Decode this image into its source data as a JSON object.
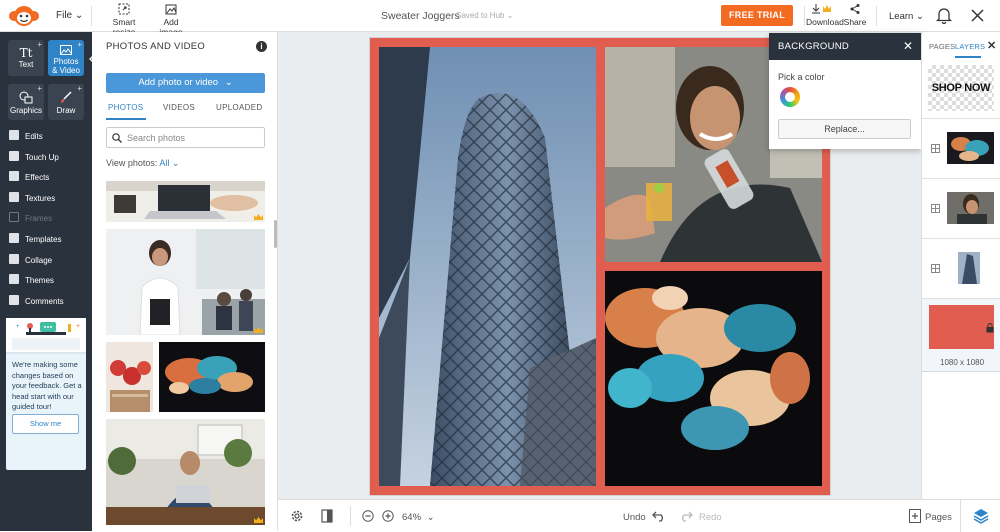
{
  "topbar": {
    "file_label": "File",
    "tools": [
      {
        "label": "Smart resize",
        "icon": "smart-resize-icon"
      },
      {
        "label": "Add image",
        "icon": "add-image-icon"
      }
    ],
    "doc_title": "Sweater Joggers",
    "saved_status": "Saved to Hub",
    "trial_label": "FREE TRIAL",
    "download_label": "Download",
    "share_label": "Share",
    "learn_label": "Learn"
  },
  "leftnav": {
    "tiles": [
      {
        "label_line1": "Text",
        "glyph": "Tt"
      },
      {
        "label_line1": "Photos",
        "label_line2": "& Video"
      },
      {
        "label_line1": "Graphics"
      },
      {
        "label_line1": "Draw"
      }
    ],
    "items": [
      {
        "label": "Edits"
      },
      {
        "label": "Touch Up"
      },
      {
        "label": "Effects"
      },
      {
        "label": "Textures"
      },
      {
        "label": "Frames"
      },
      {
        "label": "Templates"
      },
      {
        "label": "Collage"
      },
      {
        "label": "Themes"
      },
      {
        "label": "Comments"
      }
    ],
    "promo_text": "We're making some changes based on your feedback. Get a head start with our guided tour!",
    "promo_button": "Show me"
  },
  "panel": {
    "title": "PHOTOS AND VIDEO",
    "add_button": "Add photo or video",
    "tabs": [
      "PHOTOS",
      "VIDEOS",
      "UPLOADED"
    ],
    "search_placeholder": "Search photos",
    "view_label": "View photos:",
    "view_value": "All"
  },
  "background_popup": {
    "title": "BACKGROUND",
    "pick_label": "Pick a color",
    "replace_button": "Replace..."
  },
  "right_panel": {
    "tabs": [
      "PAGES",
      "LAYERS"
    ],
    "shop_now_text": "SHOP NOW",
    "size_label": "1080 x 1080"
  },
  "bottombar": {
    "zoom": "64%",
    "undo_label": "Undo",
    "redo_label": "Redo",
    "pages_label": "Pages"
  },
  "colors": {
    "accent": "#2f84c7",
    "trial": "#f26b21",
    "design_background": "#e15d50",
    "nav_bg": "#2a323d"
  }
}
